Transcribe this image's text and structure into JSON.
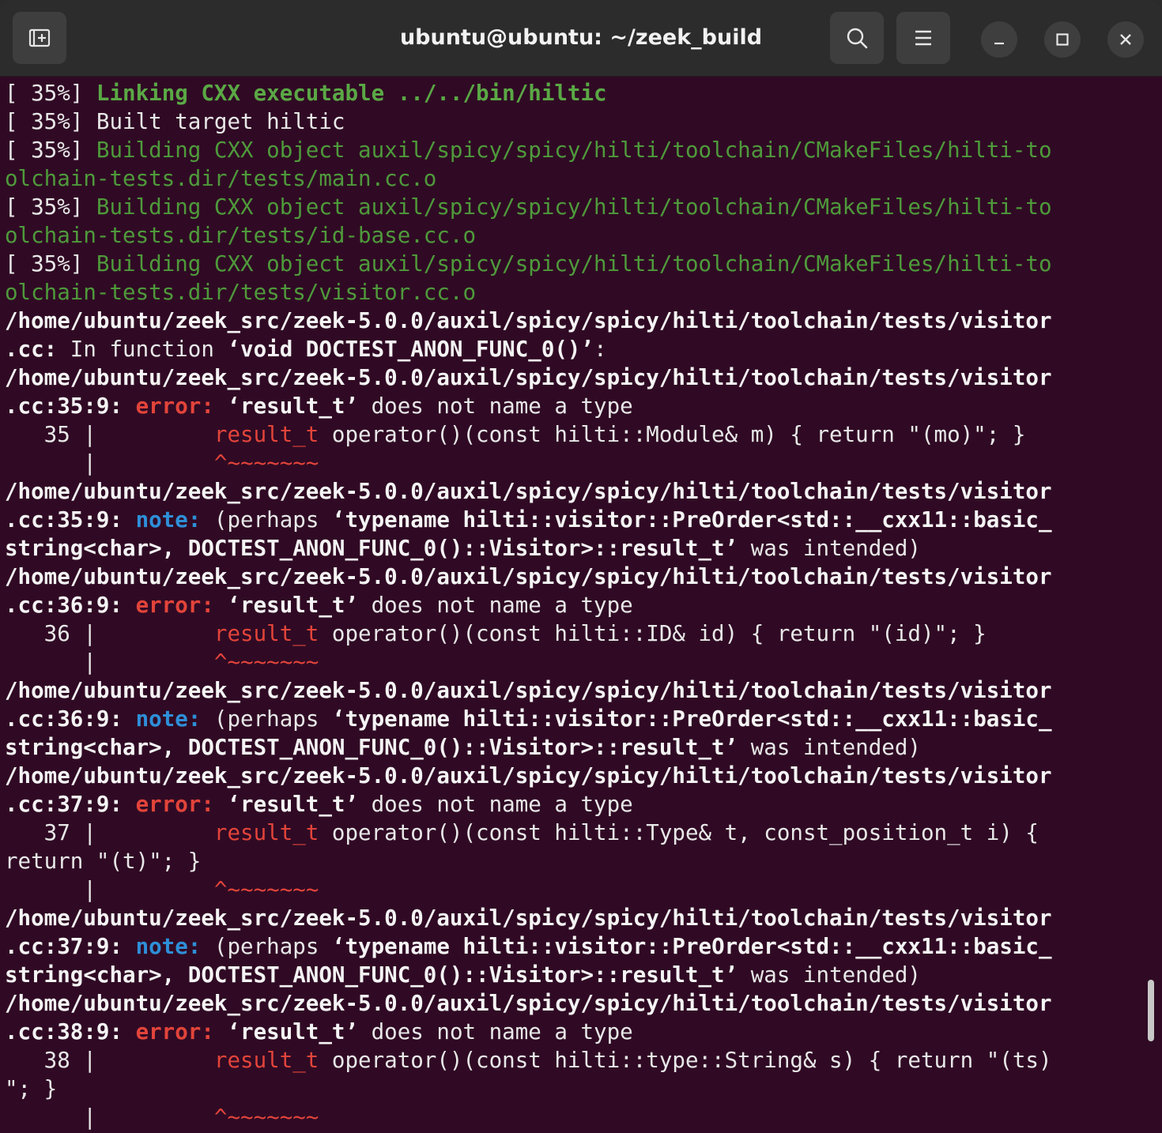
{
  "window": {
    "title": "ubuntu@ubuntu: ~/zeek_build",
    "buttons": {
      "new_tab_icon": "new-tab-icon",
      "search_icon": "search-icon",
      "menu_icon": "hamburger-menu-icon",
      "minimize_icon": "minimize-icon",
      "maximize_icon": "maximize-icon",
      "close_icon": "close-icon"
    }
  },
  "colors": {
    "background": "#300a24",
    "progress_green": "#4e9a3b",
    "error_red": "#e2443a",
    "note_blue": "#2e8fd8"
  },
  "terminal": {
    "lines": [
      {
        "kind": "progress-bold",
        "prefix": "[ 35%] ",
        "text": "Linking CXX executable ../../bin/hiltic"
      },
      {
        "kind": "plain",
        "prefix": "",
        "text": "[ 35%] Built target hiltic"
      },
      {
        "kind": "progress",
        "prefix": "[ 35%] ",
        "text": "Building CXX object auxil/spicy/spicy/hilti/toolchain/CMakeFiles/hilti-to"
      },
      {
        "kind": "progress-cont",
        "prefix": "",
        "text": "olchain-tests.dir/tests/main.cc.o"
      },
      {
        "kind": "progress",
        "prefix": "[ 35%] ",
        "text": "Building CXX object auxil/spicy/spicy/hilti/toolchain/CMakeFiles/hilti-to"
      },
      {
        "kind": "progress-cont",
        "prefix": "",
        "text": "olchain-tests.dir/tests/id-base.cc.o"
      },
      {
        "kind": "progress",
        "prefix": "[ 35%] ",
        "text": "Building CXX object auxil/spicy/spicy/hilti/toolchain/CMakeFiles/hilti-to"
      },
      {
        "kind": "progress-cont",
        "prefix": "",
        "text": "olchain-tests.dir/tests/visitor.cc.o"
      },
      {
        "kind": "path",
        "text": "/home/ubuntu/zeek_src/zeek-5.0.0/auxil/spicy/spicy/hilti/toolchain/tests/visitor"
      },
      {
        "kind": "infunc",
        "a": ".cc:",
        "b": " In function ",
        "c": "‘void DOCTEST_ANON_FUNC_0()’",
        "d": ":"
      },
      {
        "kind": "path",
        "text": "/home/ubuntu/zeek_src/zeek-5.0.0/auxil/spicy/spicy/hilti/toolchain/tests/visitor"
      },
      {
        "kind": "diag-error",
        "loc": ".cc:35:9:",
        "label": " error: ",
        "q": "‘result_t’",
        "rest": " does not name a type"
      },
      {
        "kind": "code",
        "num": "   35 | ",
        "pad": "        ",
        "hl": "result_t",
        "rest": " operator()(const hilti::Module& m) { return \"(mo)\"; }"
      },
      {
        "kind": "caret",
        "bar": "      | ",
        "pad": "        ",
        "carets": "^~~~~~~~"
      },
      {
        "kind": "path",
        "text": "/home/ubuntu/zeek_src/zeek-5.0.0/auxil/spicy/spicy/hilti/toolchain/tests/visitor"
      },
      {
        "kind": "diag-note",
        "loc": ".cc:35:9:",
        "label": " note: ",
        "rest": "(perhaps ",
        "q": "‘typename hilti::visitor::PreOrder<std::__cxx11::basic_"
      },
      {
        "kind": "note-cont",
        "q": "string<char>, DOCTEST_ANON_FUNC_0()::Visitor>::result_t’",
        "rest": " was intended)"
      },
      {
        "kind": "path",
        "text": "/home/ubuntu/zeek_src/zeek-5.0.0/auxil/spicy/spicy/hilti/toolchain/tests/visitor"
      },
      {
        "kind": "diag-error",
        "loc": ".cc:36:9:",
        "label": " error: ",
        "q": "‘result_t’",
        "rest": " does not name a type"
      },
      {
        "kind": "code",
        "num": "   36 | ",
        "pad": "        ",
        "hl": "result_t",
        "rest": " operator()(const hilti::ID& id) { return \"(id)\"; }"
      },
      {
        "kind": "caret",
        "bar": "      | ",
        "pad": "        ",
        "carets": "^~~~~~~~"
      },
      {
        "kind": "path",
        "text": "/home/ubuntu/zeek_src/zeek-5.0.0/auxil/spicy/spicy/hilti/toolchain/tests/visitor"
      },
      {
        "kind": "diag-note",
        "loc": ".cc:36:9:",
        "label": " note: ",
        "rest": "(perhaps ",
        "q": "‘typename hilti::visitor::PreOrder<std::__cxx11::basic_"
      },
      {
        "kind": "note-cont",
        "q": "string<char>, DOCTEST_ANON_FUNC_0()::Visitor>::result_t’",
        "rest": " was intended)"
      },
      {
        "kind": "path",
        "text": "/home/ubuntu/zeek_src/zeek-5.0.0/auxil/spicy/spicy/hilti/toolchain/tests/visitor"
      },
      {
        "kind": "diag-error",
        "loc": ".cc:37:9:",
        "label": " error: ",
        "q": "‘result_t’",
        "rest": " does not name a type"
      },
      {
        "kind": "code",
        "num": "   37 | ",
        "pad": "        ",
        "hl": "result_t",
        "rest": " operator()(const hilti::Type& t, const_position_t i) {"
      },
      {
        "kind": "plain",
        "prefix": "",
        "text": "return \"(t)\"; }"
      },
      {
        "kind": "caret",
        "bar": "      | ",
        "pad": "        ",
        "carets": "^~~~~~~~"
      },
      {
        "kind": "path",
        "text": "/home/ubuntu/zeek_src/zeek-5.0.0/auxil/spicy/spicy/hilti/toolchain/tests/visitor"
      },
      {
        "kind": "diag-note",
        "loc": ".cc:37:9:",
        "label": " note: ",
        "rest": "(perhaps ",
        "q": "‘typename hilti::visitor::PreOrder<std::__cxx11::basic_"
      },
      {
        "kind": "note-cont",
        "q": "string<char>, DOCTEST_ANON_FUNC_0()::Visitor>::result_t’",
        "rest": " was intended)"
      },
      {
        "kind": "path",
        "text": "/home/ubuntu/zeek_src/zeek-5.0.0/auxil/spicy/spicy/hilti/toolchain/tests/visitor"
      },
      {
        "kind": "diag-error",
        "loc": ".cc:38:9:",
        "label": " error: ",
        "q": "‘result_t’",
        "rest": " does not name a type"
      },
      {
        "kind": "code",
        "num": "   38 | ",
        "pad": "        ",
        "hl": "result_t",
        "rest": " operator()(const hilti::type::String& s) { return \"(ts)"
      },
      {
        "kind": "plain",
        "prefix": "",
        "text": "\"; }"
      },
      {
        "kind": "caret",
        "bar": "      | ",
        "pad": "        ",
        "carets": "^~~~~~~~"
      }
    ]
  }
}
